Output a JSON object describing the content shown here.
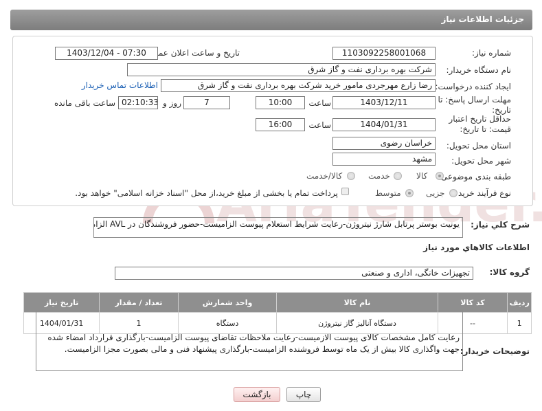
{
  "header": {
    "title": "جزئیات اطلاعات نیاز"
  },
  "form": {
    "need_number_label": "شماره نیاز:",
    "need_number": "1103092258001068",
    "announce_label": "تاریخ و ساعت اعلان عمومی:",
    "announce_value": "1403/12/04 - 07:30",
    "buyer_org_label": "نام دستگاه خریدار:",
    "buyer_org": "شرکت بهره برداری نفت و گاز شرق",
    "creator_label": "ایجاد کننده درخواست:",
    "creator": "رضا زارع مهرجردی مامور خرید شرکت بهره برداری نفت و گاز شرق",
    "contact_link": "اطلاعات تماس خریدار",
    "deadline_label": "مهلت ارسال پاسخ: تا تاریخ:",
    "deadline_date": "1403/12/11",
    "time_label": "ساعت",
    "deadline_time": "10:00",
    "days_value": "7",
    "days_label": "روز و",
    "remaining_value": "02:10:33",
    "remaining_label": "ساعت باقی مانده",
    "validity_label": "حداقل تاریخ اعتبار قیمت: تا تاریخ:",
    "validity_date": "1404/01/31",
    "validity_time": "16:00",
    "province_label": "استان محل تحویل:",
    "province": "خراسان رضوی",
    "city_label": "شهر محل تحویل:",
    "city": "مشهد",
    "category_label": "طبقه بندی موضوعی:",
    "category_options": [
      "کالا",
      "خدمت",
      "کالا/خدمت"
    ],
    "process_label": "نوع فرآیند خرید :",
    "process_options": [
      "جزیی",
      "متوسط"
    ],
    "payment_note": "پرداخت تمام یا بخشی از مبلغ خرید،از محل \"اسناد خزانه اسلامی\" خواهد بود."
  },
  "summary": {
    "label": "شرح کلي نياز:",
    "text": "یونیت بوستر پرتابل شارژ نیتروژن-رعایت شرایط استعلام پیوست الزامیست-حضور فروشندگان در AVL الزامیست"
  },
  "goods": {
    "section_title": "اطلاعات کالاهاي مورد نياز",
    "group_label": "گروه کالا:",
    "group_value": "تجهیزات خانگی، اداری و صنعتی"
  },
  "table": {
    "headers": [
      "ردیف",
      "کد کالا",
      "نام کالا",
      "واحد شمارش",
      "تعداد / مقدار",
      "تاریخ نیاز"
    ],
    "rows": [
      [
        "1",
        "--",
        "دستگاه آنالیز گاز نیتروژن",
        "دستگاه",
        "1",
        "1404/01/31"
      ]
    ]
  },
  "buyer_notes": {
    "label": "توضیحات خریدار:",
    "text": "رعایت کامل مشخصات کالای پیوست الازمیست-رعایت ملاحظات تقاضای پیوست الزامیست-بارگذاری قرارداد امضاء شده جهت واگذاری کالا بیش از یک ماه توسط فروشنده الزامیست-بارگذاری پیشنهاد فنی و مالی بصورت مجزا الزامیست."
  },
  "buttons": {
    "print": "چاپ",
    "back": "بازگشت"
  },
  "watermark": {
    "text": "AriaTender.neT"
  }
}
